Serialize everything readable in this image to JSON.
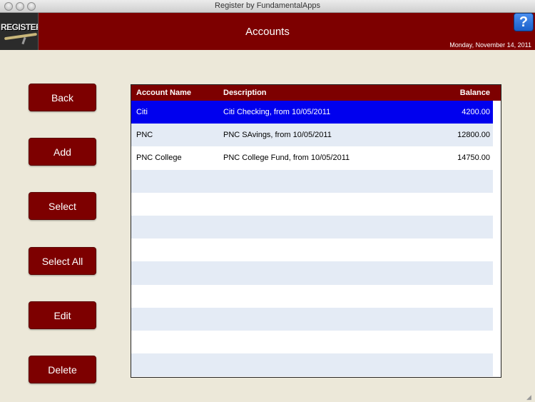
{
  "window": {
    "title": "Register by FundamentalApps"
  },
  "header": {
    "logo_text": "REGISTER",
    "title": "Accounts",
    "help_label": "?",
    "date": "Monday, November 14, 2011"
  },
  "sidebar": {
    "buttons": [
      {
        "label": "Back"
      },
      {
        "label": "Add"
      },
      {
        "label": "Select"
      },
      {
        "label": "Select All"
      },
      {
        "label": "Edit"
      },
      {
        "label": "Delete"
      }
    ]
  },
  "table": {
    "columns": [
      "Account Name",
      "Description",
      "Balance"
    ],
    "rows": [
      {
        "name": "Citi",
        "description": "Citi Checking, from 10/05/2011",
        "balance": "4200.00",
        "selected": true
      },
      {
        "name": "PNC",
        "description": "PNC SAvings, from 10/05/2011",
        "balance": "12800.00",
        "selected": false
      },
      {
        "name": "PNC College",
        "description": "PNC College Fund, from 10/05/2011",
        "balance": "14750.00",
        "selected": false
      }
    ],
    "empty_rows": 9
  },
  "colors": {
    "header_bg": "#7d0000",
    "selected_row": "#0000ee",
    "alt_row": "#e4ebf5",
    "page_bg": "#ece8d9"
  }
}
